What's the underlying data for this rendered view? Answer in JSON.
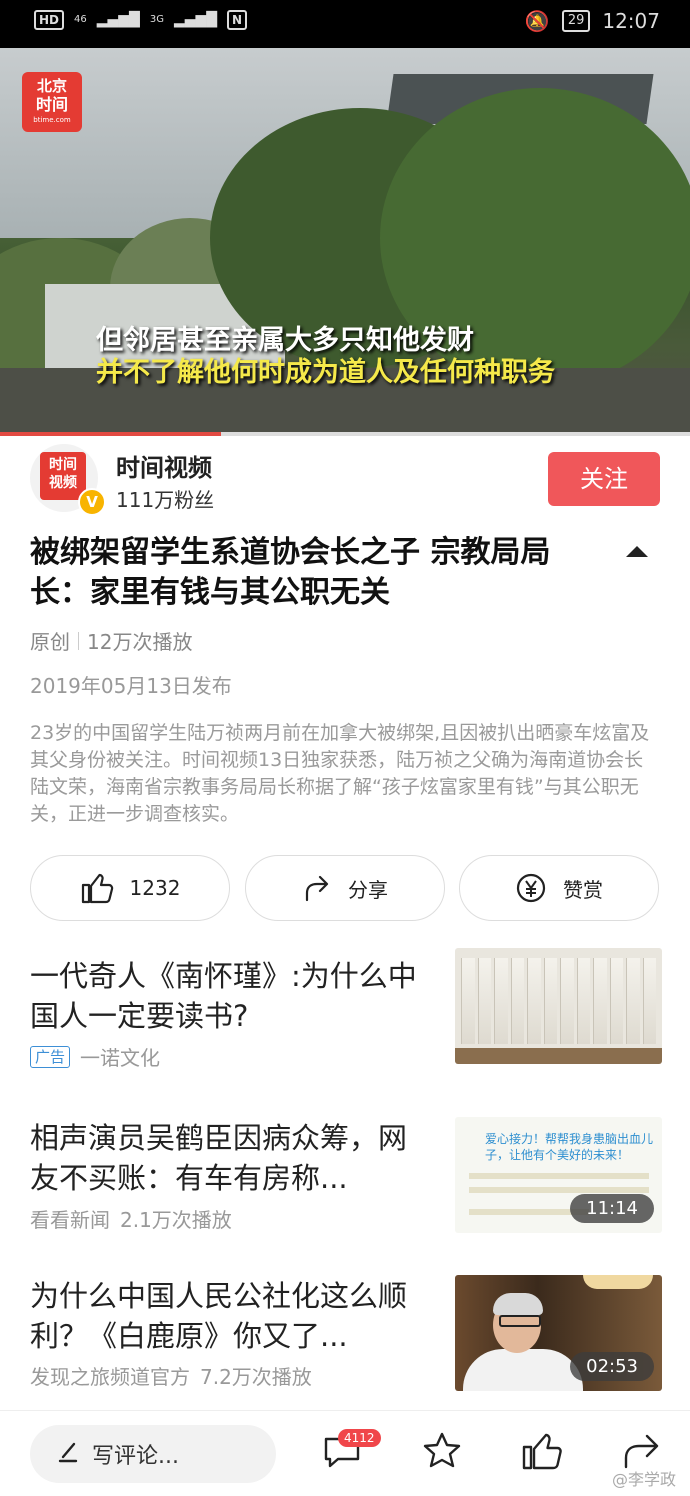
{
  "status_bar": {
    "hd": "HD",
    "net1": "46",
    "net2": "3G",
    "nfc": "N",
    "battery": "29",
    "time": "12:07"
  },
  "video": {
    "logo_line1": "北京",
    "logo_line2": "时间",
    "logo_line3": "btime.com",
    "subtitle_1": "但邻居甚至亲属大多只知他发财",
    "subtitle_2": "并不了解他何时成为道人及任何种职务",
    "progress": 0.32
  },
  "author": {
    "avatar_text_1": "时间",
    "avatar_text_2": "视频",
    "verified": "V",
    "name": "时间视频",
    "fans": "111万粉丝",
    "follow_label": "关注"
  },
  "article": {
    "title": "被绑架留学生系道协会长之子 宗教局局长：家里有钱与其公职无关",
    "original": "原创",
    "plays": "12万次播放",
    "date": "2019年05月13日发布",
    "description": "23岁的中国留学生陆万祯两月前在加拿大被绑架,且因被扒出晒豪车炫富及其父身份被关注。时间视频13日独家获悉，陆万祯之父确为海南道协会长陆文荣，海南省宗教事务局局长称据了解“孩子炫富家里有钱”与其公职无关，正进一步调查核实。"
  },
  "actions": {
    "like_count": "1232",
    "share_label": "分享",
    "reward_label": "赞赏"
  },
  "recommendations": [
    {
      "title": "一代奇人《南怀瑾》:为什么中国人一定要读书?",
      "ad_tag": "广告",
      "source": "一诺文化"
    },
    {
      "title": "相声演员吴鹤臣因病众筹，网友不买账：有车有房称...",
      "source": "看看新闻",
      "plays": "2.1万次播放",
      "duration": "11:14",
      "thumb_text": "爱心接力！帮帮我身患脑出血儿子，让他有个美好的未来！"
    },
    {
      "title": "为什么中国人民公社化这么顺利？《白鹿原》你又了...",
      "source": "发现之旅频道官方",
      "plays": "7.2万次播放",
      "duration": "02:53"
    }
  ],
  "bottom_bar": {
    "comment_placeholder": "写评论...",
    "comment_count": "4112"
  },
  "watermark": "@李学政",
  "colors": {
    "accent": "#f0575a",
    "ad_blue": "#3d8fd6",
    "subtitle_yellow": "#f5e94a"
  }
}
